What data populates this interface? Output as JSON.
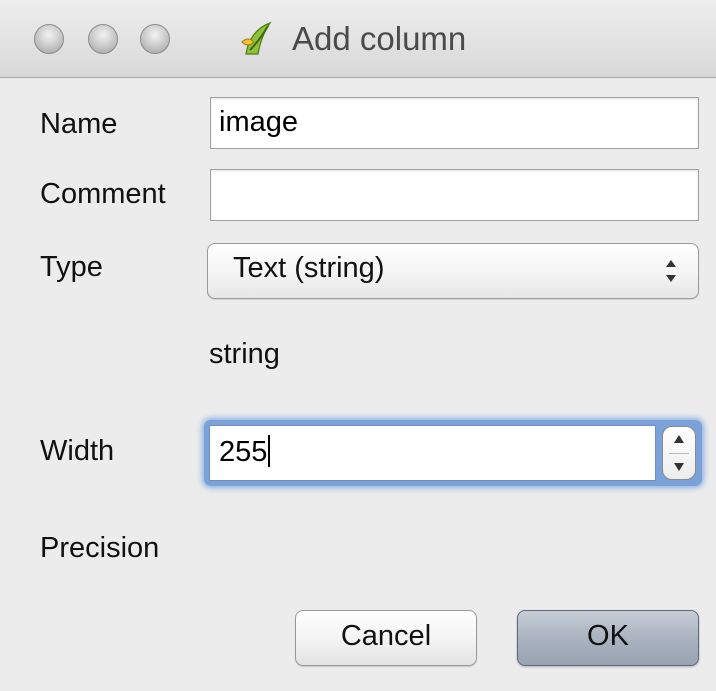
{
  "window": {
    "title": "Add column",
    "title_icon": "qgis-logo-icon"
  },
  "form": {
    "name_label": "Name",
    "name_value": "image",
    "comment_label": "Comment",
    "comment_value": "",
    "type_label": "Type",
    "type_selected": "Text (string)",
    "type_description": "string",
    "width_label": "Width",
    "width_value": "255",
    "precision_label": "Precision"
  },
  "buttons": {
    "cancel": "Cancel",
    "ok": "OK"
  },
  "colors": {
    "focus_ring": "#7aa2d8",
    "window_background": "#ececec",
    "default_button": "#aab3c0"
  }
}
